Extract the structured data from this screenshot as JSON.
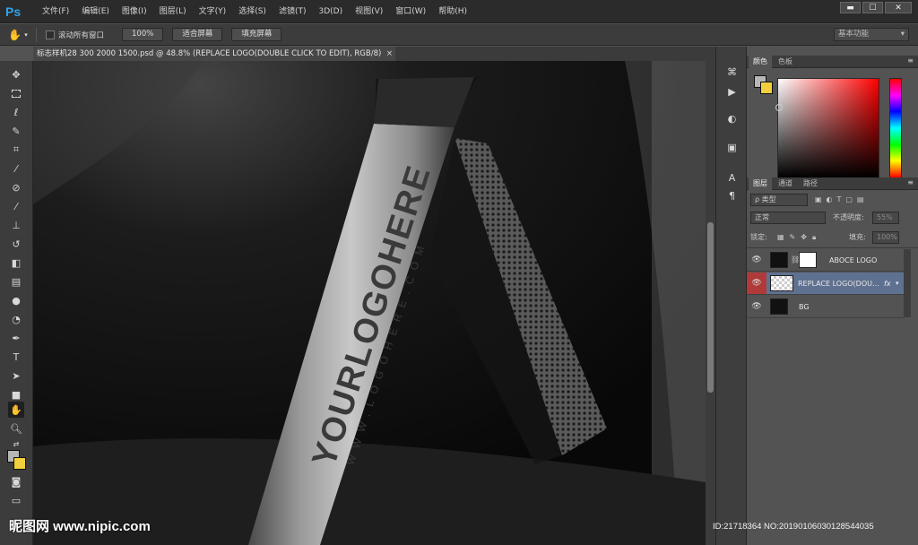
{
  "app": {
    "logo": "Ps"
  },
  "menu": [
    "文件(F)",
    "编辑(E)",
    "图像(I)",
    "图层(L)",
    "文字(Y)",
    "选择(S)",
    "滤镜(T)",
    "3D(D)",
    "视图(V)",
    "窗口(W)",
    "帮助(H)"
  ],
  "window_controls": {
    "minimize": "▬",
    "maximize": "☐",
    "close": "✕"
  },
  "options": {
    "scroll_all_label": "滚动所有窗口",
    "zoom_100": "100%",
    "fit_screen": "适合屏幕",
    "fill_screen": "填充屏幕",
    "workspace": "基本功能"
  },
  "document": {
    "tab_title": "标志样机28 300 2000 1500.psd @ 48.8% (REPLACE LOGO(DOUBLE CLICK TO EDIT), RGB/8)",
    "close": "×",
    "logo_main": "YOURLOGOHERE",
    "logo_url": "WWW.LOGOHERE.COM"
  },
  "panels": {
    "color_tabs": [
      "颜色",
      "色板"
    ],
    "layer_tabs": [
      "图层",
      "通道",
      "路径"
    ],
    "filter_kind": "ρ 类型",
    "blend_mode": "正常",
    "opacity_label": "不透明度:",
    "opacity_value": "55%",
    "lock_label": "锁定:",
    "fill_label": "填充:",
    "fill_value": "100%",
    "fx": "fx",
    "colors": {
      "fg": "#b6b6b6",
      "bg": "#f2cf3d"
    }
  },
  "layers": [
    {
      "name": "ABOCE LOGO",
      "selected": false
    },
    {
      "name": "REPLACE LOGO(DOU...",
      "selected": true
    },
    {
      "name": "BG",
      "selected": false
    }
  ],
  "watermark": {
    "site": "昵图网 www.nipic.com",
    "info": "ID:21718364 NO:20190106030128544035"
  }
}
